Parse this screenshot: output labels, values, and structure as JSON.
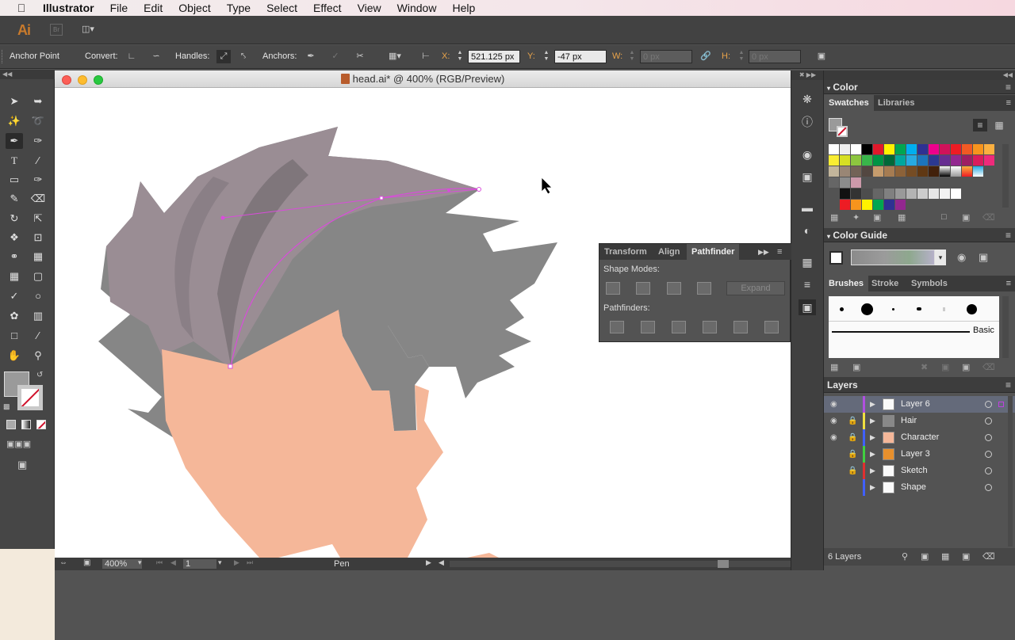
{
  "menubar": {
    "app": "Illustrator",
    "items": [
      "File",
      "Edit",
      "Object",
      "Type",
      "Select",
      "Effect",
      "View",
      "Window",
      "Help"
    ]
  },
  "appbar": {
    "logo": "Ai",
    "br": "Br"
  },
  "control": {
    "tool_label": "Anchor Point",
    "convert_label": "Convert:",
    "handles_label": "Handles:",
    "anchors_label": "Anchors:",
    "x_label": "X:",
    "x_value": "521.125 px",
    "y_label": "Y:",
    "y_value": "-47 px",
    "w_label": "W:",
    "w_value": "0 px",
    "h_label": "H:",
    "h_value": "0 px"
  },
  "document": {
    "title": "head.ai* @ 400% (RGB/Preview)",
    "zoom": "400%",
    "artboard": "1",
    "status_tool": "Pen"
  },
  "panels": {
    "color": {
      "title": "Color"
    },
    "swatches": {
      "tabs": [
        "Swatches",
        "Libraries"
      ]
    },
    "color_guide": {
      "title": "Color Guide"
    },
    "brushes": {
      "tabs": [
        "Brushes",
        "Stroke",
        "Symbols"
      ],
      "basic_label": "Basic"
    },
    "pathfinder": {
      "tabs": [
        "Transform",
        "Align",
        "Pathfinder"
      ],
      "shape_modes_label": "Shape Modes:",
      "expand_label": "Expand",
      "pathfinders_label": "Pathfinders:"
    },
    "layers": {
      "title": "Layers",
      "count_label": "6 Layers",
      "items": [
        {
          "name": "Layer 6",
          "color": "#b050e0",
          "selected": true
        },
        {
          "name": "Hair",
          "color": "#f0e040",
          "selected": false
        },
        {
          "name": "Character",
          "color": "#4060ff",
          "selected": false
        },
        {
          "name": "Layer 3",
          "color": "#40d040",
          "selected": false
        },
        {
          "name": "Sketch",
          "color": "#e03030",
          "selected": false
        },
        {
          "name": "Shape",
          "color": "#4060ff",
          "selected": false
        }
      ]
    }
  },
  "colors": {
    "hair_dark": "#868686",
    "hair_light": "#9a8d94",
    "skin": "#f5b799",
    "path_selection": "#d94cdb",
    "ui_panel": "#535353"
  }
}
